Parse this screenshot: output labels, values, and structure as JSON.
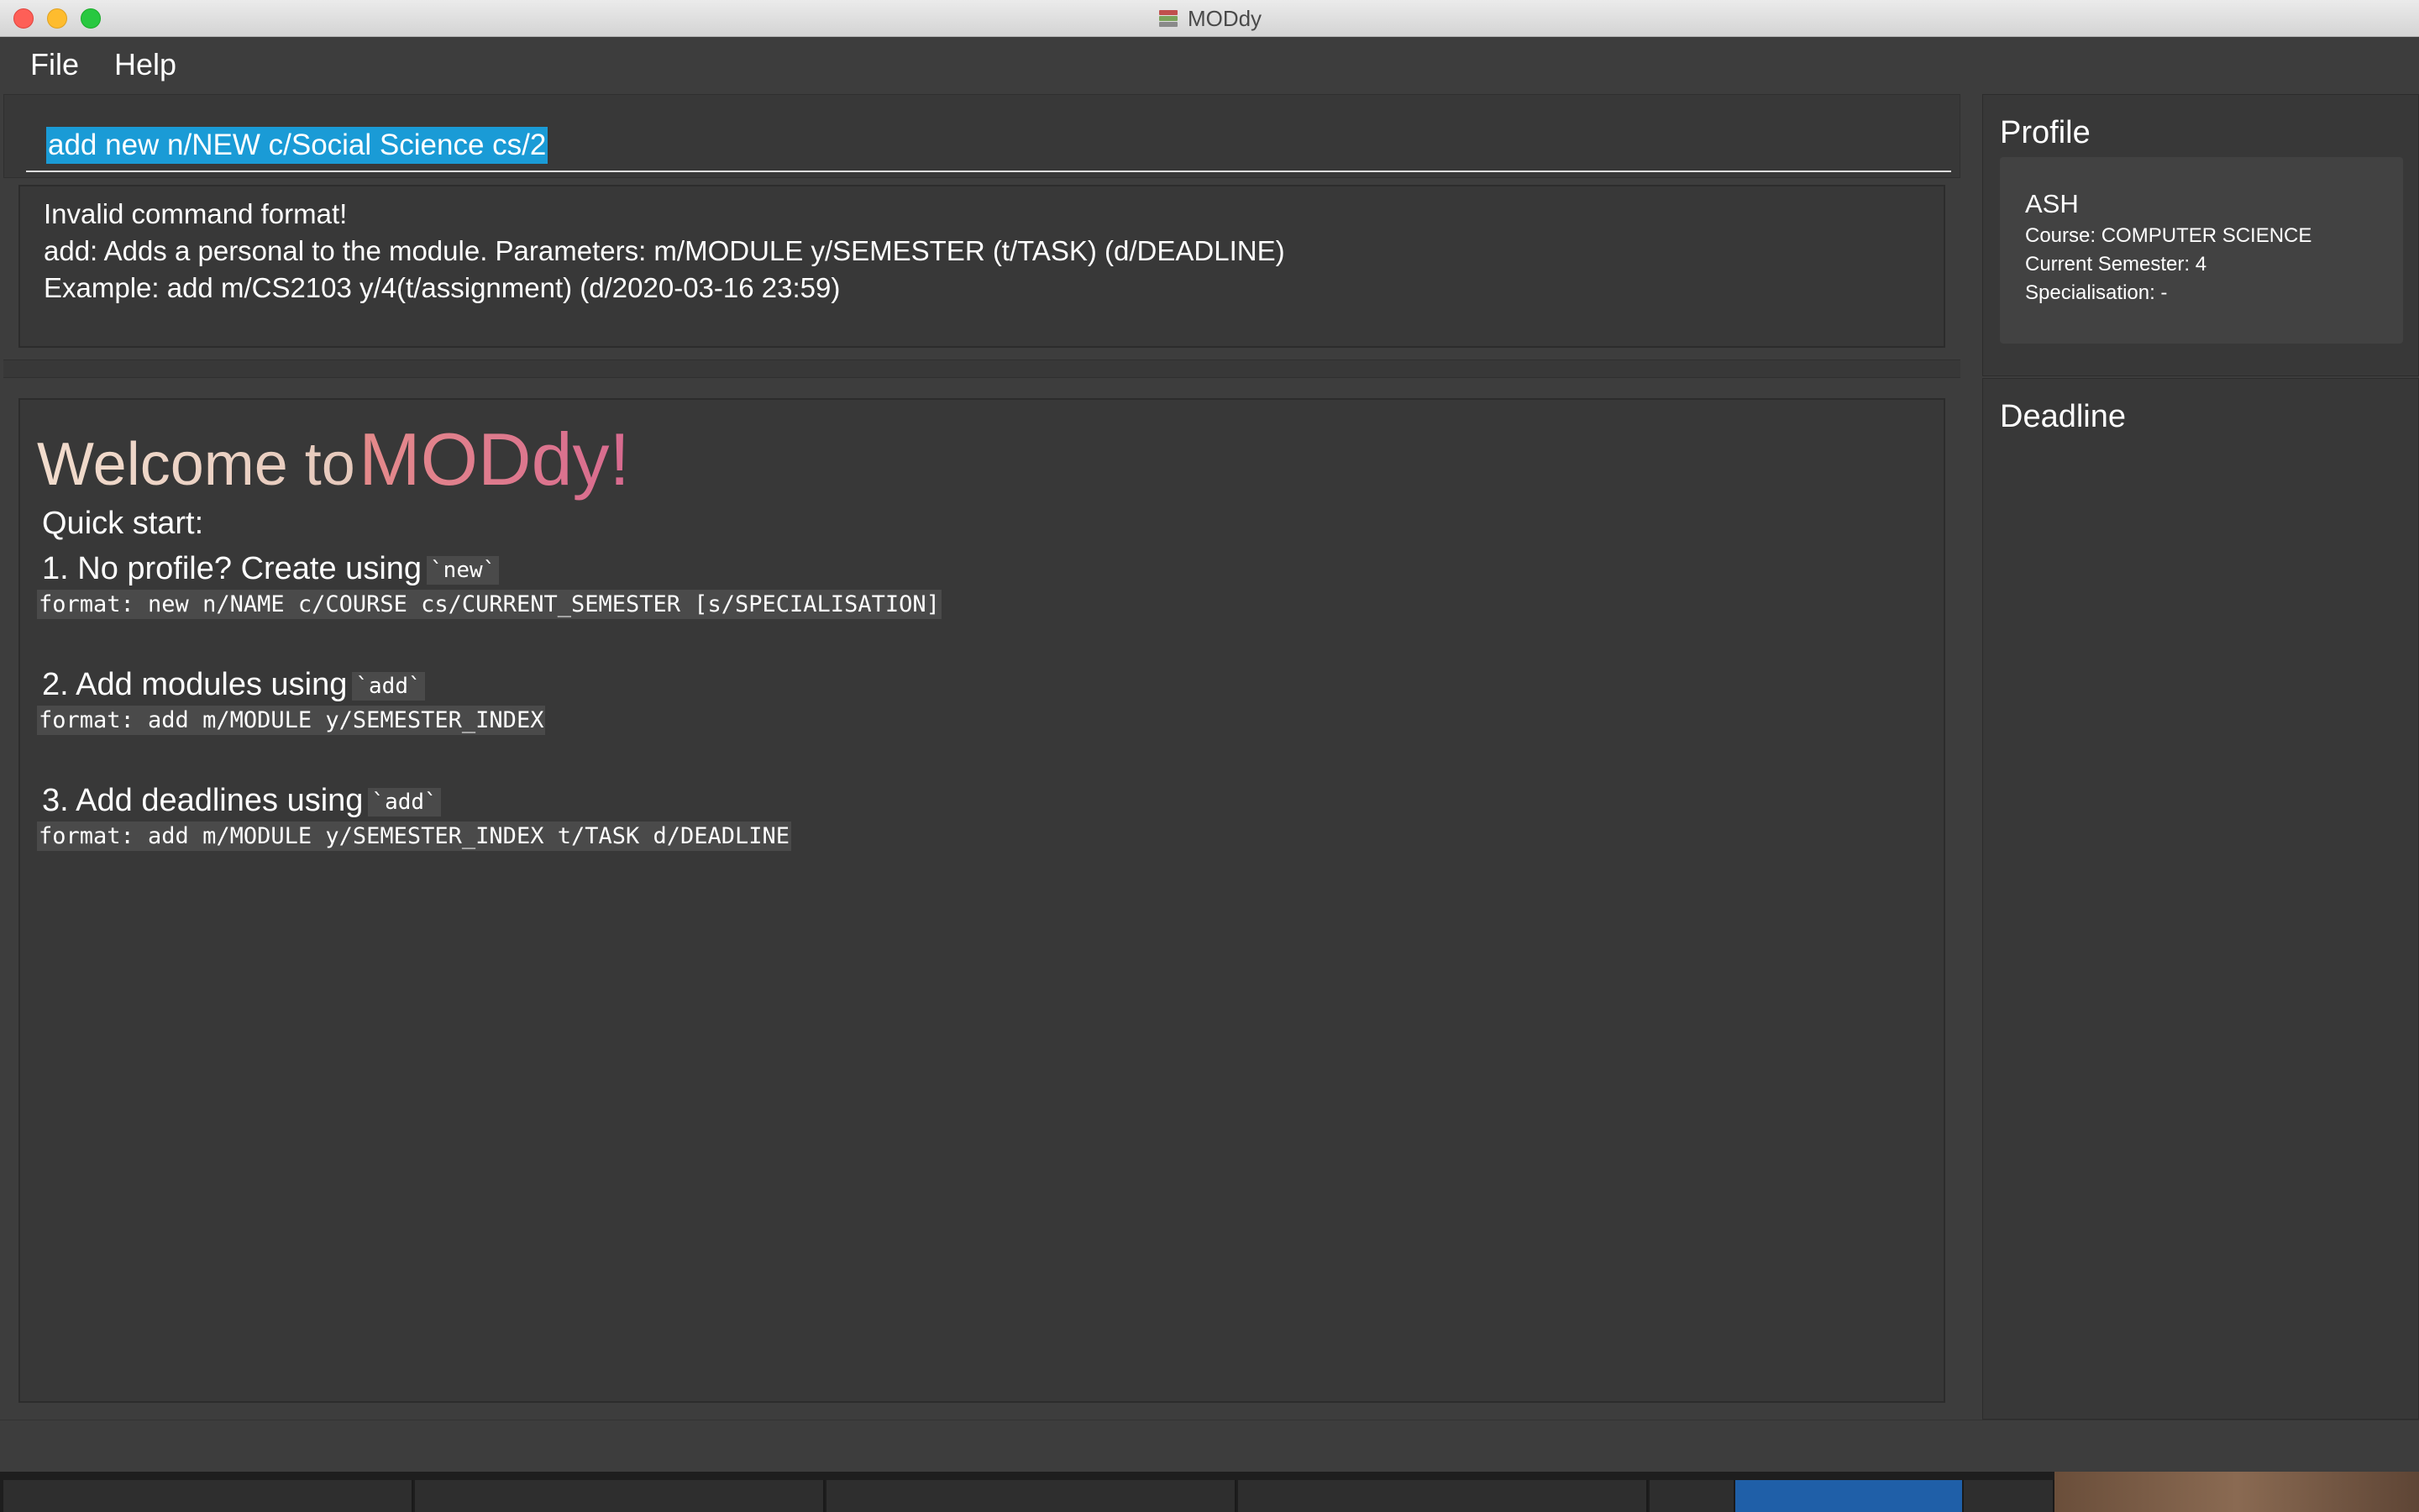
{
  "window": {
    "title": "MODdy"
  },
  "menu": {
    "items": [
      "File",
      "Help"
    ]
  },
  "command": {
    "value": "add new n/NEW c/Social Science cs/2"
  },
  "result": {
    "lines": [
      "Invalid command format!",
      "add: Adds a personal to the module. Parameters: m/MODULE y/SEMESTER (t/TASK) (d/DEADLINE)",
      "Example: add m/CS2103 y/4(t/assignment) (d/2020-03-16 23:59)"
    ]
  },
  "welcome": {
    "lead": "Welcome to",
    "brand": "MODdy!",
    "quick_start": "Quick start:",
    "steps": [
      {
        "text": "1. No profile? Create using",
        "tag": "`new`",
        "format": "format: new n/NAME c/COURSE cs/CURRENT_SEMESTER [s/SPECIALISATION]"
      },
      {
        "text": "2. Add modules using",
        "tag": "`add`",
        "format": "format: add m/MODULE y/SEMESTER_INDEX"
      },
      {
        "text": "3. Add deadlines using",
        "tag": "`add`",
        "format": "format: add m/MODULE y/SEMESTER_INDEX t/TASK d/DEADLINE"
      }
    ]
  },
  "profile": {
    "title": "Profile",
    "name": "ASH",
    "course": "Course: COMPUTER SCIENCE",
    "semester": "Current Semester: 4",
    "specialisation": "Specialisation: -"
  },
  "deadline": {
    "title": "Deadline"
  },
  "colors": {
    "background": "#3d3d3d",
    "panel": "#383838",
    "selection": "#1a9bd6",
    "brand_gradient_start": "#e58b8b",
    "brand_gradient_end": "#d86a8f"
  },
  "icons": [
    "close-button",
    "minimize-button",
    "zoom-button",
    "app-books-icon"
  ]
}
